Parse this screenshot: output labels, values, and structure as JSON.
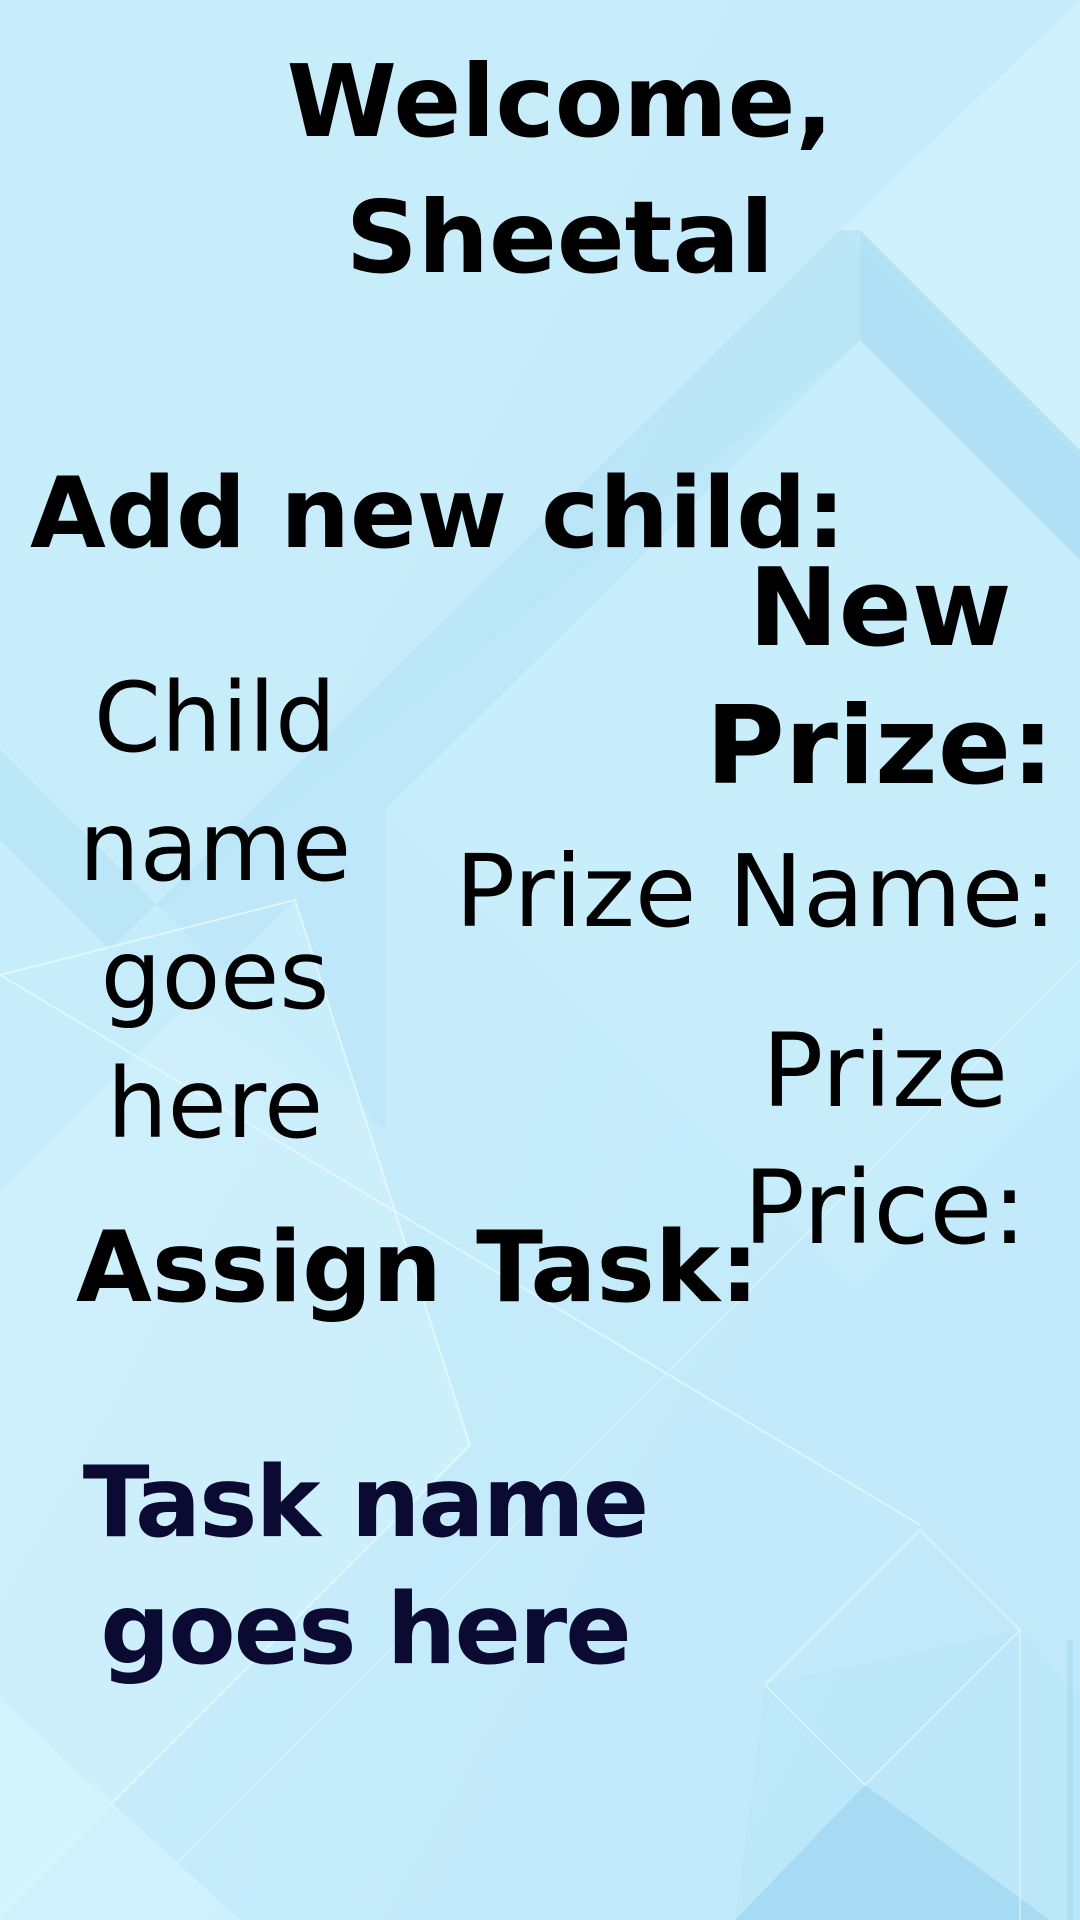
{
  "welcome": {
    "greeting": "Welcome,\nSheetal"
  },
  "child_section": {
    "heading": "Add new child:",
    "child_name_placeholder": "Child\nname\ngoes\nhere"
  },
  "prize_section": {
    "heading": "New\nPrize:",
    "name_label": "Prize Name:",
    "price_label": "Prize\nPrice:"
  },
  "task_section": {
    "heading": "Assign Task:",
    "task_name_placeholder": "Task name\ngoes here"
  },
  "colors": {
    "background_light": "#d4f3fb",
    "background_mid": "#b8e6f7",
    "background_shade": "#9fd8f1",
    "text": "#000000",
    "task_text": "#0a0a33"
  }
}
